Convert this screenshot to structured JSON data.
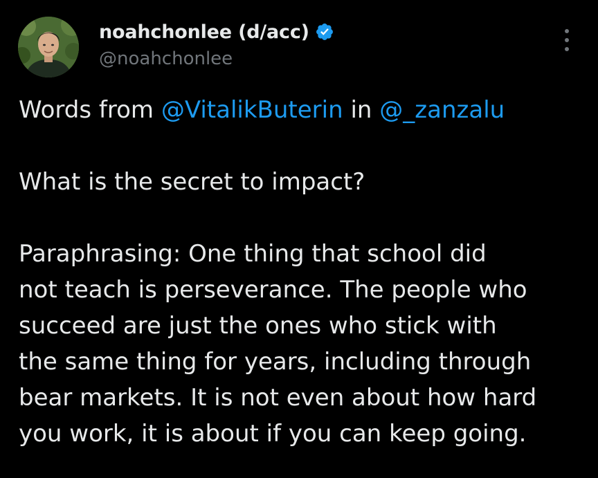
{
  "author": {
    "display_name": "noahchonlee (d/acc)",
    "handle": "@noahchonlee",
    "verified": true,
    "avatar_icon": "profile-photo",
    "verified_icon": "verified-badge-icon",
    "verified_color": "#1d9bf0"
  },
  "actions": {
    "more_icon": "more-vertical-icon"
  },
  "tweet": {
    "intro_prefix": "Words from ",
    "mention_1": "@VitalikButerin",
    "intro_middle": " in ",
    "mention_2": "@_zanzalu",
    "question": "What is the secret to impact?",
    "quote_lines": [
      "Paraphrasing: One thing that school did",
      "not teach is perseverance. The people who",
      "succeed are just the ones who stick with",
      "the same thing for years, including through",
      "bear markets. It is not even about how hard",
      "you work, it is about if you can keep going."
    ]
  },
  "colors": {
    "background": "#000000",
    "text": "#e7e9ea",
    "secondary_text": "#71767b",
    "link": "#1d9bf0"
  }
}
